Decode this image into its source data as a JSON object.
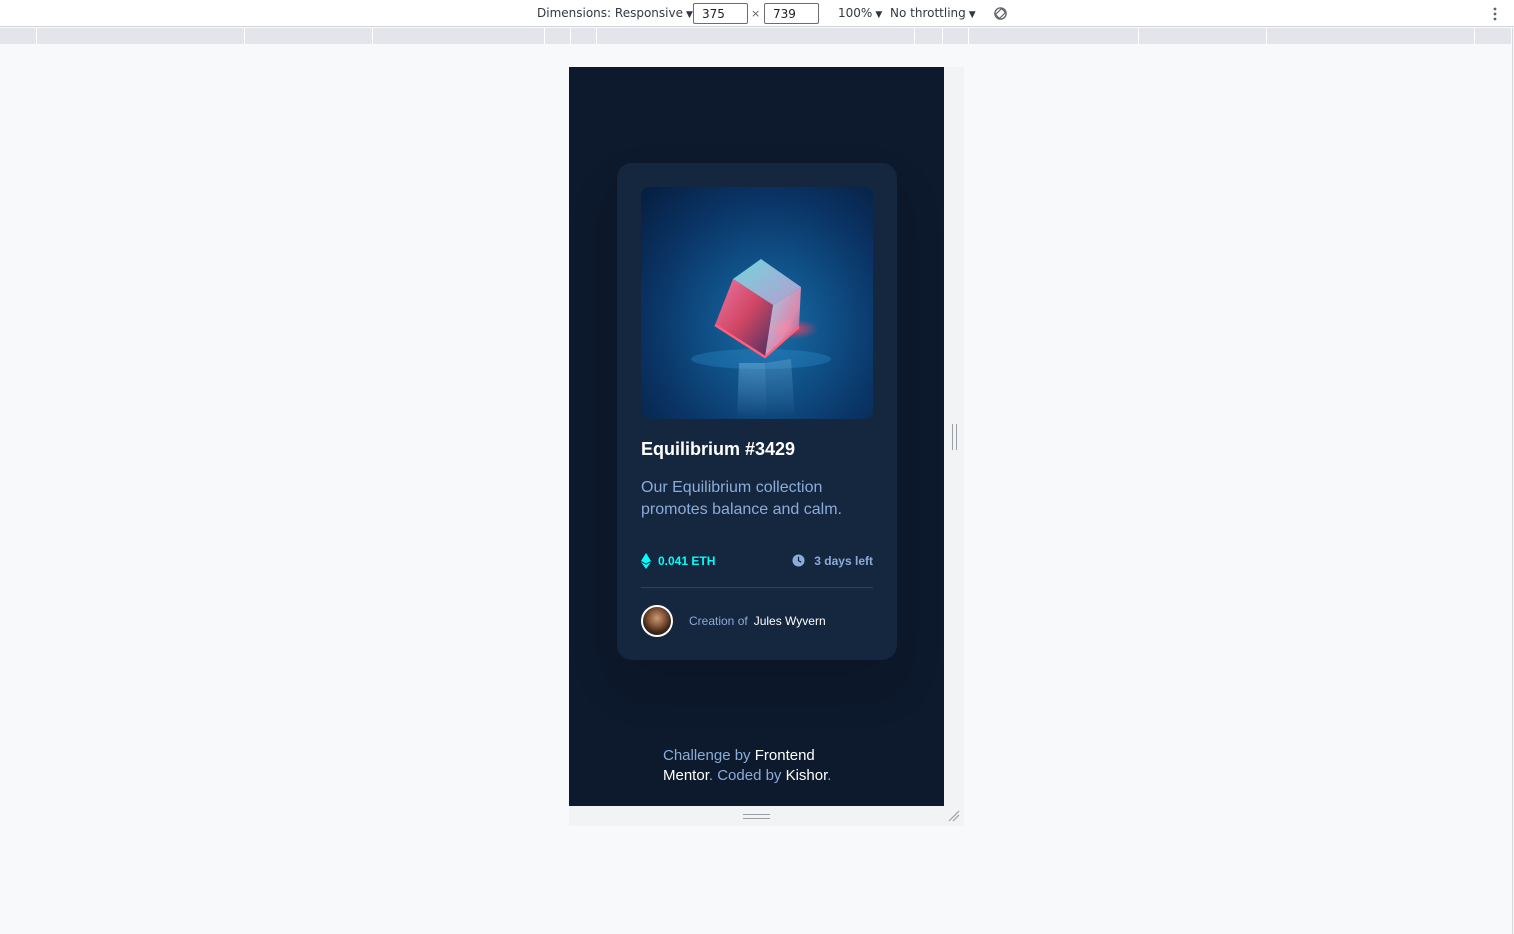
{
  "devtools": {
    "dimensions_label": "Dimensions: Responsive",
    "width_value": "375",
    "height_value": "739",
    "times_sign": "×",
    "zoom": "100%",
    "throttling": "No throttling"
  },
  "card": {
    "title": "Equilibrium #3429",
    "description": "Our Equilibrium collection promotes balance and calm.",
    "price": "0.041 ETH",
    "time_left": "3 days left",
    "creation_prefix": "Creation of",
    "creator_name": "Jules Wyvern"
  },
  "footer": {
    "challenge_by": "Challenge by",
    "frontend_mentor": "Frontend Mentor",
    "coded_by": "Coded by",
    "author": "Kishor",
    "period": "."
  },
  "colors": {
    "page_bg": "#0d192c",
    "card_bg": "#15263f",
    "cyan": "#00fff8",
    "soft_blue": "#8bacd9",
    "white": "#ffffff"
  }
}
